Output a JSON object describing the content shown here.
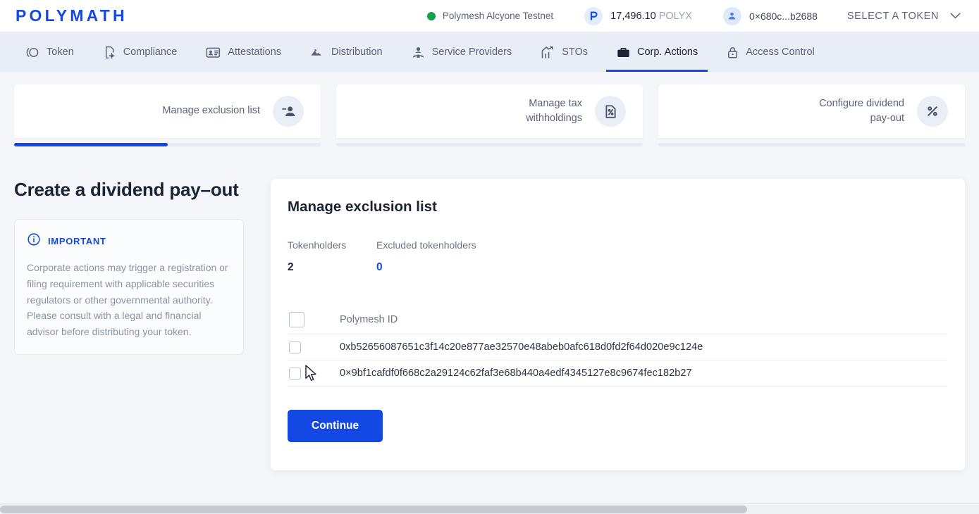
{
  "header": {
    "logo": "POLYMATH",
    "network": {
      "label": "Polymesh Alcyone Testnet",
      "status_color": "#17a04a",
      "icon": "status-dot-icon"
    },
    "balance": {
      "amount": "17,496.10",
      "unit": "POLYX",
      "icon": "polyx-logo-icon"
    },
    "account": {
      "address": "0×680c...b2688",
      "icon": "user-avatar-icon"
    },
    "token_selector": {
      "label": "SELECT A TOKEN",
      "icon": "chevron-down-icon"
    }
  },
  "nav": {
    "tabs": [
      {
        "label": "Token",
        "icon": "token-circle-icon",
        "active": false
      },
      {
        "label": "Compliance",
        "icon": "document-gear-icon",
        "active": false
      },
      {
        "label": "Attestations",
        "icon": "id-card-gear-icon",
        "active": false
      },
      {
        "label": "Distribution",
        "icon": "mountains-icon",
        "active": false
      },
      {
        "label": "Service Providers",
        "icon": "person-group-icon",
        "active": false
      },
      {
        "label": "STOs",
        "icon": "bar-chart-arrow-icon",
        "active": false
      },
      {
        "label": "Corp. Actions",
        "icon": "briefcase-icon",
        "active": true
      },
      {
        "label": "Access Control",
        "icon": "lock-icon",
        "active": false
      }
    ],
    "active_accent": "#1348e5"
  },
  "stepper": {
    "steps": [
      {
        "label": "Manage exclusion list",
        "icon": "person-remove-icon",
        "progress": 50
      },
      {
        "label": "Manage tax withholdings",
        "icon": "document-percent-icon",
        "progress": 0
      },
      {
        "label": "Configure dividend pay-out",
        "icon": "percent-icon",
        "progress": 0
      }
    ]
  },
  "left": {
    "title": "Create a dividend pay–out",
    "notice": {
      "icon": "info-circle-icon",
      "title": "IMPORTANT",
      "body": "Corporate actions may trigger a registration or filing requirement with applicable securities regulators or other governmental authority. Please consult with a legal and financial advisor before distributing your token.",
      "accent": "#1348e5"
    }
  },
  "card": {
    "title": "Manage exclusion list",
    "stats": [
      {
        "label": "Tokenholders",
        "value": "2",
        "accent": false
      },
      {
        "label": "Excluded tokenholders",
        "value": "0",
        "accent": true
      }
    ],
    "table": {
      "select_all": {
        "name": "select-all-checkbox",
        "checked": false
      },
      "columns": [
        "Polymesh ID"
      ],
      "rows": [
        {
          "checked": false,
          "polymesh_id": "0xb52656087651c3f14c20e877ae32570e48abeb0afc618d0fd2f64d020e9c124e"
        },
        {
          "checked": false,
          "polymesh_id": "0×9bf1cafdf0f668c2a29124c62faf3e68b440a4edf4345127e8c9674fec182b27"
        }
      ]
    },
    "continue_label": "Continue",
    "button_color": "#1348e5"
  }
}
